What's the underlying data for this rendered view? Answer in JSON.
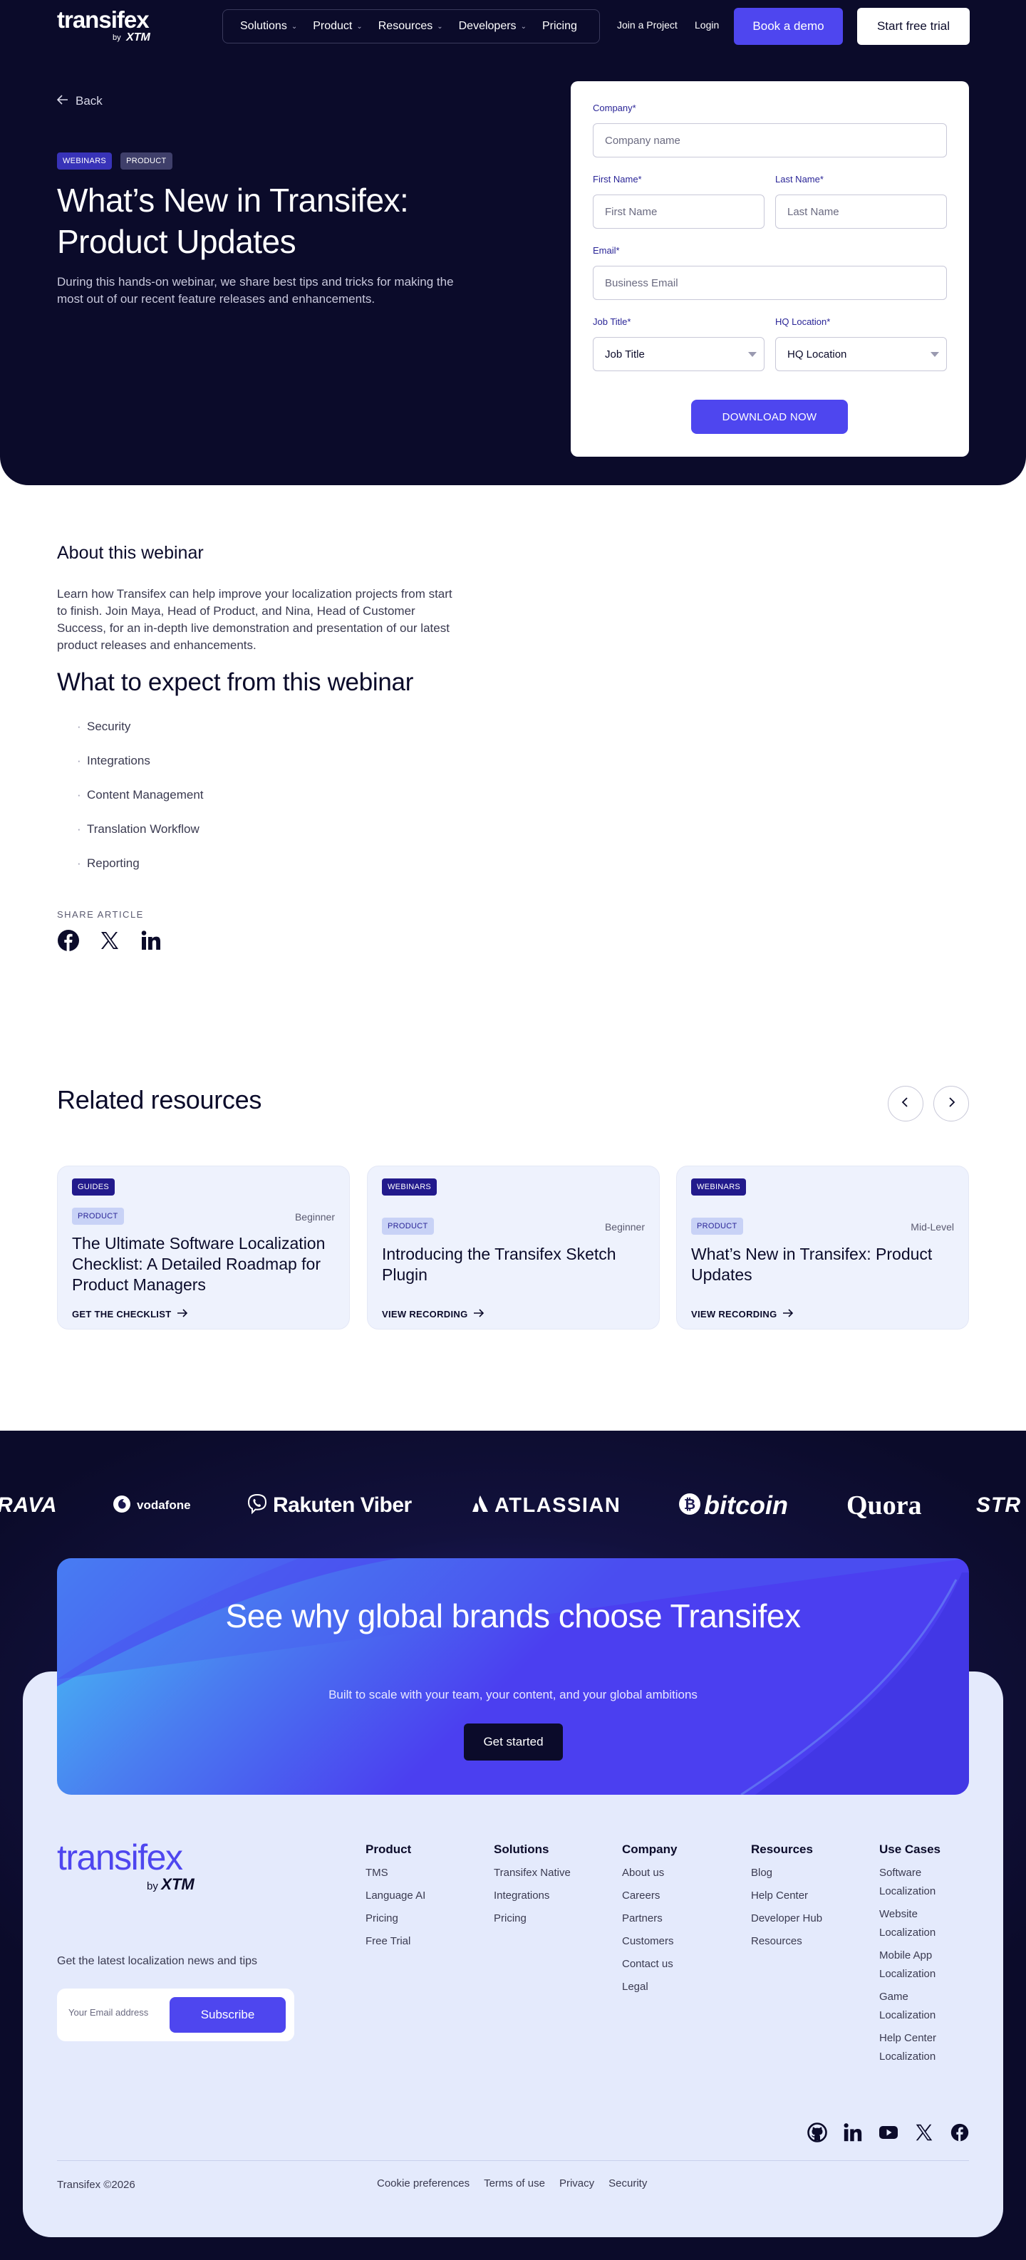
{
  "header": {
    "logo_word": "transifex",
    "logo_by": "by",
    "logo_xtm": "XTM",
    "nav": [
      "Solutions",
      "Product",
      "Resources",
      "Developers",
      "Pricing"
    ],
    "join_project": "Join a Project",
    "login": "Login",
    "book_demo": "Book a demo",
    "start_trial": "Start free trial"
  },
  "hero": {
    "back": "Back",
    "tags": [
      "WEBINARS",
      "PRODUCT"
    ],
    "title": "What’s New in Transifex: Product Updates",
    "description": "During this hands-on webinar, we share best tips and tricks for making the most out of our recent feature releases and enhancements."
  },
  "form": {
    "company_label": "Company*",
    "company_placeholder": "Company name",
    "first_name_label": "First Name*",
    "first_name_placeholder": "First Name",
    "last_name_label": "Last Name*",
    "last_name_placeholder": "Last Name",
    "email_label": "Email*",
    "email_placeholder": "Business Email",
    "job_title_label": "Job Title*",
    "job_title_value": "Job Title",
    "hq_label": "HQ Location*",
    "hq_value": "HQ Location",
    "submit": "DOWNLOAD NOW"
  },
  "about": {
    "title": "About this webinar",
    "text": "Learn how Transifex can help improve your localization projects from start to finish. Join Maya, Head of Product, and Nina, Head of Customer Success, for an in-depth live demonstration and presentation of our latest product releases and enhancements.",
    "expect_title": "What to expect from this webinar",
    "expect_items": [
      "Security",
      "Integrations",
      "Content Management",
      "Translation Workflow",
      "Reporting"
    ],
    "share_label": "SHARE ARTICLE"
  },
  "related": {
    "title": "Related resources",
    "cards": [
      {
        "tag": "GUIDES",
        "product": "PRODUCT",
        "level": "Beginner",
        "title": "The Ultimate Software Localization Checklist: A Detailed Roadmap for Product Managers",
        "link": "GET THE CHECKLIST"
      },
      {
        "tag": "WEBINARS",
        "product": "PRODUCT",
        "level": "Beginner",
        "title": "Introducing the Transifex Sketch Plugin",
        "link": "VIEW RECORDING"
      },
      {
        "tag": "WEBINARS",
        "product": "PRODUCT",
        "level": "Mid-Level",
        "title": "What’s New in Transifex: Product Updates",
        "link": "VIEW RECORDING"
      }
    ]
  },
  "logos": [
    "RAVA",
    "vodafone",
    "Rakuten Viber",
    "ATLASSIAN",
    "bitcoin",
    "Quora",
    "STR"
  ],
  "cta": {
    "title": "See why global brands choose Transifex",
    "subtitle": "Built to scale with your team, your content, and your global ambitions",
    "button": "Get started"
  },
  "footer": {
    "logo_word": "transifex",
    "logo_by": "by",
    "logo_xtm": "XTM",
    "news_label": "Get the latest localization news and tips",
    "email_placeholder": "Your Email address",
    "subscribe": "Subscribe",
    "columns": [
      {
        "title": "Product",
        "links": [
          "TMS",
          "Language AI",
          "Pricing",
          "Free Trial"
        ]
      },
      {
        "title": "Solutions",
        "links": [
          "Transifex Native",
          "Integrations",
          "Pricing"
        ]
      },
      {
        "title": "Company",
        "links": [
          "About us",
          "Careers",
          "Partners",
          "Customers",
          "Contact us",
          "Legal"
        ]
      },
      {
        "title": "Resources",
        "links": [
          "Blog",
          "Help Center",
          "Developer Hub",
          "Resources"
        ]
      },
      {
        "title": "Use Cases",
        "links": [
          "Software Localization",
          "Website Localization",
          "Mobile App Localization",
          "Game Localization",
          "Help Center Localization"
        ]
      }
    ],
    "copyright": "Transifex ©2026",
    "legal": [
      "Cookie preferences",
      "Terms of use",
      "Privacy",
      "Security"
    ]
  },
  "colors": {
    "brand": "#4e46ef",
    "dark": "#0b0b2a",
    "panel": "#e4eafc"
  }
}
